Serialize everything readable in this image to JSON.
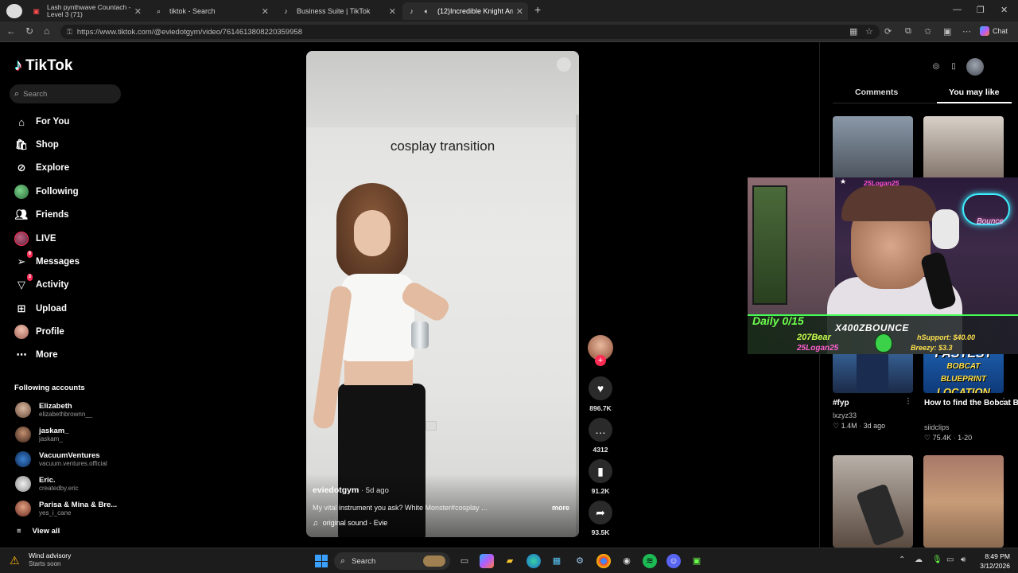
{
  "browser": {
    "tabs": [
      {
        "title": "Lash pynthwave Countach - 12 H...",
        "overlay": "Level 3 (71)",
        "active": false
      },
      {
        "title": "tiktok - Search",
        "active": false
      },
      {
        "title": "Business Suite | TikTok",
        "active": false
      },
      {
        "title": "(12)Incredible Knight Armor C...",
        "active": true
      }
    ],
    "new_tab": "+",
    "url": "https://www.tiktok.com/@eviedotgym/video/7614613808220359958",
    "chat_label": "Chat"
  },
  "sidebar": {
    "logo": "TikTok",
    "search_placeholder": "Search",
    "nav": [
      {
        "label": "For You",
        "icon": "home-icon"
      },
      {
        "label": "Shop",
        "icon": "shop-icon"
      },
      {
        "label": "Explore",
        "icon": "compass-icon"
      },
      {
        "label": "Following",
        "icon": "following-avatar-icon"
      },
      {
        "label": "Friends",
        "icon": "friends-icon"
      },
      {
        "label": "LIVE",
        "icon": "live-avatar-icon"
      },
      {
        "label": "Messages",
        "icon": "messages-icon",
        "badge": "9"
      },
      {
        "label": "Activity",
        "icon": "activity-icon",
        "badge": "3"
      },
      {
        "label": "Upload",
        "icon": "upload-icon"
      },
      {
        "label": "Profile",
        "icon": "profile-avatar-icon"
      },
      {
        "label": "More",
        "icon": "more-icon"
      }
    ],
    "following_title": "Following accounts",
    "following": [
      {
        "name": "Elizabeth",
        "handle": "elizabethbrownn__"
      },
      {
        "name": "jaskam_",
        "handle": "jaskam_"
      },
      {
        "name": "VacuumVentures",
        "handle": "vacuum.ventures.official"
      },
      {
        "name": "Eric.",
        "handle": "createdby.eric"
      },
      {
        "name": "Parisa & Mina & Bre...",
        "handle": "yes_i_cane"
      }
    ],
    "view_all": "View all"
  },
  "video": {
    "overlay_text": "cosplay transition",
    "username": "eviedotgym",
    "age": " · 5d ago",
    "description": "My vital instrument you ask? White Monster#cosplay ...",
    "more": "more",
    "sound": "original sound - Evie",
    "likes": "896.7K",
    "comments": "4312",
    "saves": "91.2K",
    "shares": "93.5K"
  },
  "right": {
    "tabs": [
      "Comments",
      "You may like"
    ],
    "cards": [
      {
        "title": "#fyp",
        "author": "lxzyz33",
        "likes": "1.4M",
        "time": "3d ago"
      },
      {
        "title": "How to find the Bobcat Blueprint...",
        "author": "siidclips",
        "likes": "75.4K",
        "time": "1-20"
      }
    ],
    "thumb_text": [
      "FASTEST",
      "BOBCAT BLUEPRINT",
      "LOCATION"
    ]
  },
  "stream": {
    "top_text": "25Logan25",
    "neon_text": "Bounce",
    "daily": "Daily 0/15",
    "brand": "X400ZBOUNCE",
    "follower1": "207Bear",
    "follower2": "25Logan25",
    "sub1": "hSupport: $40.00",
    "sub2": "Breezy: $3.3"
  },
  "taskbar": {
    "weather_title": "Wind advisory",
    "weather_sub": "Starts soon",
    "search": "Search",
    "time": "8:49 PM",
    "date": "3/12/2026"
  },
  "colors": {
    "accent": "#fe2c55",
    "cyan": "#25f4ee",
    "stream_green": "#6dff4d"
  }
}
